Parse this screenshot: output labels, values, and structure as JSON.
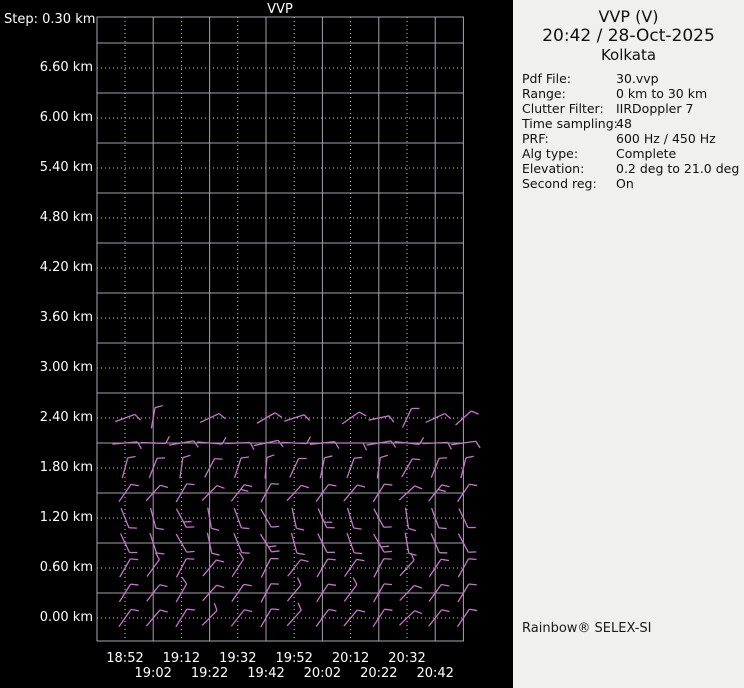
{
  "chart": {
    "title": "VVP",
    "step_label": "Step: 0.30 km",
    "y_labels": [
      "6.60 km",
      "6.00 km",
      "5.40 km",
      "4.80 km",
      "4.20 km",
      "3.60 km",
      "3.00 km",
      "2.40 km",
      "1.80 km",
      "1.20 km",
      "0.60 km",
      "0.00 km"
    ],
    "x_labels_row1": [
      "18:52",
      "19:12",
      "19:32",
      "19:52",
      "20:12",
      "20:32"
    ],
    "x_labels_row2": [
      "19:02",
      "19:22",
      "19:42",
      "20:02",
      "20:22",
      "20:42"
    ],
    "colors": {
      "background": "#000000",
      "grid_solid": "#a2a2aa",
      "grid_dotted": "#cacaca",
      "frame": "#a8a8b0",
      "barb": "#c873ce",
      "text": "#ffffff"
    }
  },
  "panel": {
    "title": "VVP (V)",
    "datetime": "20:42 / 28-Oct-2025",
    "station": "Kolkata",
    "fields": [
      {
        "label": "Pdf File:",
        "value": "30.vvp"
      },
      {
        "label": "Range:",
        "value": "0 km to 30 km"
      },
      {
        "label": "Clutter Filter:",
        "value": "IIRDoppler 7"
      },
      {
        "label": "Time sampling:",
        "value": "48"
      },
      {
        "label": "PRF:",
        "value": "600 Hz / 450 Hz"
      },
      {
        "label": "Alg type:",
        "value": "Complete"
      },
      {
        "label": "Elevation:",
        "value": "0.2 deg to 21.0 deg"
      },
      {
        "label": "Second reg:",
        "value": "On"
      }
    ],
    "footer": "Rainbow® SELEX-SI",
    "background": "#f0f0ee"
  },
  "chart_data": {
    "type": "wind-barb-time-height",
    "title": "VVP",
    "xlabel_times": [
      "18:52",
      "19:02",
      "19:12",
      "19:22",
      "19:32",
      "19:42",
      "19:52",
      "20:02",
      "20:12",
      "20:22",
      "20:32",
      "20:42"
    ],
    "n_time_columns": 13,
    "altitude_step_km": 0.3,
    "altitude_axis_km": [
      0.0,
      7.2
    ],
    "barb_rows": [
      {
        "alt_km": 0.0,
        "dirs": [
          35,
          40,
          32,
          45,
          38,
          30,
          42,
          36,
          40,
          33,
          46,
          38,
          34
        ],
        "ticks": [
          1,
          1,
          1,
          -1,
          1,
          1,
          -1,
          1,
          1,
          1,
          1,
          1,
          1
        ],
        "len": 21
      },
      {
        "alt_km": 0.3,
        "dirs": [
          32,
          38,
          30,
          42,
          35,
          28,
          40,
          33,
          37,
          30,
          44,
          36,
          31
        ],
        "ticks": [
          1,
          1,
          -1,
          1,
          1,
          1,
          -1,
          1,
          -1,
          1,
          1,
          1,
          1
        ],
        "len": 21
      },
      {
        "alt_km": 0.6,
        "dirs": [
          30,
          36,
          28,
          40,
          33,
          26,
          38,
          31,
          35,
          28,
          42,
          34,
          29
        ],
        "ticks": [
          1,
          -1,
          1,
          1,
          -1,
          1,
          1,
          1,
          1,
          1,
          -1,
          1,
          1
        ],
        "len": 21
      },
      {
        "alt_km": 0.9,
        "dirs": [
          155,
          162,
          150,
          168,
          158,
          148,
          165,
          154,
          160,
          150,
          170,
          157,
          152
        ],
        "ticks": [
          1,
          1,
          1,
          1,
          1,
          2,
          1,
          1,
          1,
          2,
          1,
          1,
          1
        ],
        "len": 21
      },
      {
        "alt_km": 1.2,
        "dirs": [
          158,
          165,
          152,
          170,
          160,
          150,
          168,
          156,
          163,
          152,
          172,
          160,
          155
        ],
        "ticks": [
          1,
          1,
          2,
          1,
          1,
          1,
          1,
          2,
          1,
          1,
          1,
          1,
          1
        ],
        "len": 21
      },
      {
        "alt_km": 1.5,
        "dirs": [
          35,
          42,
          30,
          45,
          38,
          28,
          43,
          36,
          40,
          32,
          47,
          39,
          34
        ],
        "ticks": [
          1,
          1,
          1,
          1,
          2,
          1,
          1,
          1,
          1,
          1,
          1,
          2,
          1
        ],
        "len": 21
      },
      {
        "alt_km": 1.8,
        "dirs": [
          15,
          22,
          8,
          28,
          18,
          5,
          25,
          12,
          20,
          8,
          30,
          22,
          14
        ],
        "ticks": [
          1,
          1,
          1,
          1,
          1,
          1,
          1,
          1,
          1,
          1,
          1,
          1,
          1
        ],
        "len": 21
      },
      {
        "alt_km": 2.1,
        "dirs": [
          85,
          92,
          80,
          95,
          88,
          78,
          93,
          84,
          90,
          80,
          96,
          87,
          82
        ],
        "ticks": [
          1,
          1,
          1,
          1,
          1,
          1,
          1,
          1,
          1,
          1,
          1,
          1,
          1
        ],
        "len": 25
      },
      {
        "alt_km": 2.4,
        "dirs": [
          70,
          10,
          null,
          65,
          null,
          60,
          72,
          null,
          55,
          78,
          25,
          65,
          48
        ],
        "ticks": [
          1,
          1,
          0,
          1,
          0,
          1,
          1,
          0,
          1,
          1,
          1,
          1,
          1
        ],
        "len": 21
      }
    ]
  }
}
